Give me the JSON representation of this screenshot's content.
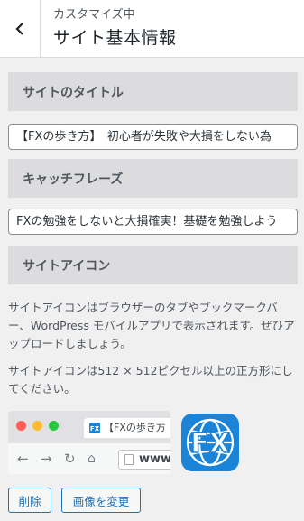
{
  "header": {
    "subtitle": "カスタマイズ中",
    "title": "サイト基本情報",
    "back_icon": "chevron-left-icon"
  },
  "site_title": {
    "label": "サイトのタイトル",
    "value": "【FXの歩き方】　初心者が失敗や大損をしない為"
  },
  "tagline": {
    "label": "キャッチフレーズ",
    "value": "FXの勉強をしないと大損確実！基礎を勉強しよう"
  },
  "site_icon": {
    "label": "サイトアイコン",
    "description": "サイトアイコンはブラウザーのタブやブックマークバー、WordPress モバイルアプリで表示されます。ぜひアップロードしましょう。",
    "size_note": "サイトアイコンは512 × 512ピクセル以上の正方形にしてください。",
    "preview": {
      "tab_title": "【FXの歩き方",
      "url_text": "www.",
      "icon_text": "FX"
    },
    "remove_label": "削除",
    "change_label": "画像を変更"
  },
  "colors": {
    "accent": "#2271b1",
    "icon_blue": "#1b84d8",
    "dot_red": "#ff5f57",
    "dot_yellow": "#febc2e",
    "dot_green": "#28c840"
  }
}
